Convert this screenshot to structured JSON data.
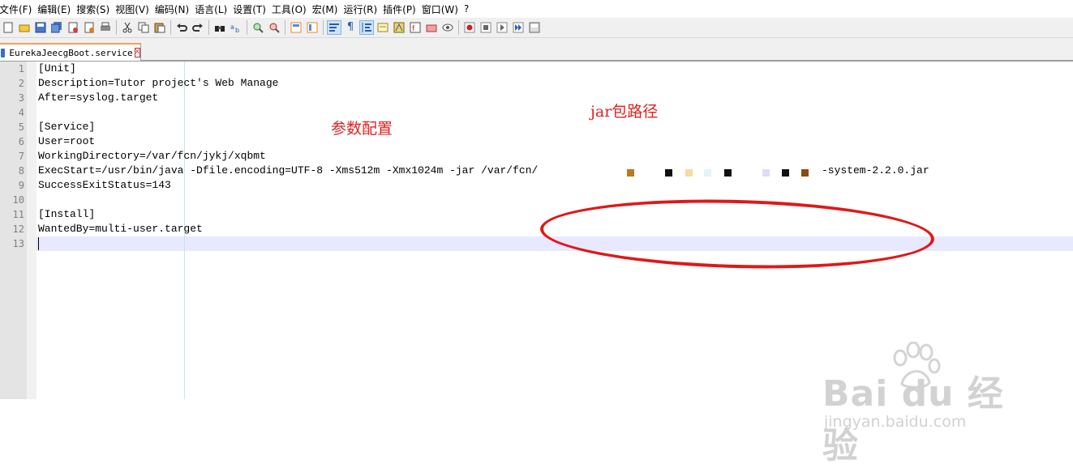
{
  "menu": [
    "文件(F)",
    "编辑(E)",
    "搜索(S)",
    "视图(V)",
    "编码(N)",
    "语言(L)",
    "设置(T)",
    "工具(O)",
    "宏(M)",
    "运行(R)",
    "插件(P)",
    "窗口(W)",
    "?"
  ],
  "toolbar_icons": [
    "new-file-icon",
    "open-file-icon",
    "save-icon",
    "save-all-icon",
    "close-icon",
    "close-all-icon",
    "print-icon",
    "cut-icon",
    "copy-icon",
    "paste-icon",
    "undo-icon",
    "redo-icon",
    "find-icon",
    "replace-icon",
    "zoom-in-icon",
    "zoom-out-icon",
    "sync-vertical-icon",
    "sync-horizontal-icon",
    "word-wrap-icon",
    "show-all-chars-icon",
    "indent-guide-icon",
    "user-language-icon",
    "doc-map-icon",
    "function-list-icon",
    "folder-workspace-icon",
    "monitoring-icon",
    "record-macro-icon",
    "stop-macro-icon",
    "play-macro-icon",
    "run-macro-multiple-icon",
    "save-macro-icon"
  ],
  "tab": {
    "title": "EurekaJeecgBoot.service",
    "close": "x"
  },
  "editor": {
    "line_numbers": [
      "1",
      "2",
      "3",
      "4",
      "5",
      "6",
      "7",
      "8",
      "9",
      "10",
      "11",
      "12",
      "13"
    ],
    "lines": [
      "[Unit]",
      "Description=Tutor project's Web Manage",
      "After=syslog.target",
      "",
      "[Service]",
      "User=root",
      "WorkingDirectory=/var/fcn/jykj/xqbmt",
      "ExecStart=/usr/bin/java -Dfile.encoding=UTF-8 -Xms512m -Xmx1024m -jar /var/fcn/",
      "SuccessExitStatus=143",
      "",
      "[Install]",
      "WantedBy=multi-user.target",
      ""
    ],
    "line8_tail": "-system-2.2.0.jar"
  },
  "annotations": {
    "params": "参数配置",
    "jar_path": "jar包路径"
  },
  "watermark": {
    "logo": "Bai du 经验",
    "url": "jingyan.baidu.com"
  },
  "colors": {
    "annotation": "#e02020",
    "current_line": "#e8e8ff",
    "tab_accent": "#f2a05a"
  }
}
